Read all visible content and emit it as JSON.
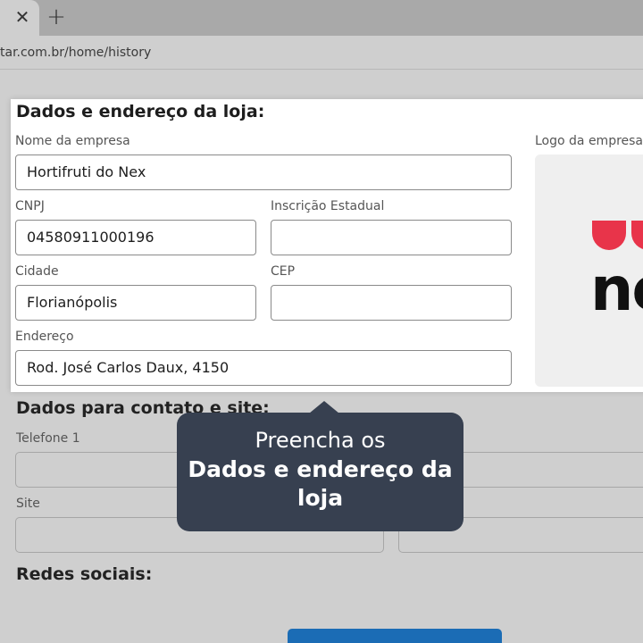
{
  "browser": {
    "close_tab_icon": "close-icon",
    "close_tab_glyph": "✕",
    "new_tab_glyph": "+",
    "url": "tar.com.br/home/history"
  },
  "store_card": {
    "title": "Dados e endereço da loja:",
    "company_name_label": "Nome da empresa",
    "company_name_value": "Hortifruti do Nex",
    "cnpj_label": "CNPJ",
    "cnpj_value": "04580911000196",
    "state_registration_label": "Inscrição Estadual",
    "state_registration_value": "",
    "city_label": "Cidade",
    "city_value": "Florianópolis",
    "cep_label": "CEP",
    "cep_value": "",
    "address_label": "Endereço",
    "address_value": "Rod. José Carlos Daux, 4150",
    "logo_label": "Logo da empresa",
    "logo_text": "ne"
  },
  "contact_section": {
    "title": "Dados para contato e site:",
    "phone1_label": "Telefone 1",
    "site_label": "Site"
  },
  "social_section": {
    "title": "Redes sociais:"
  },
  "tooltip": {
    "line1": "Preencha os",
    "line2": "Dados e endereço da loja"
  },
  "colors": {
    "tooltip_bg": "#374050",
    "logo_red": "#e8344a",
    "button_blue": "#1b6cb5"
  }
}
